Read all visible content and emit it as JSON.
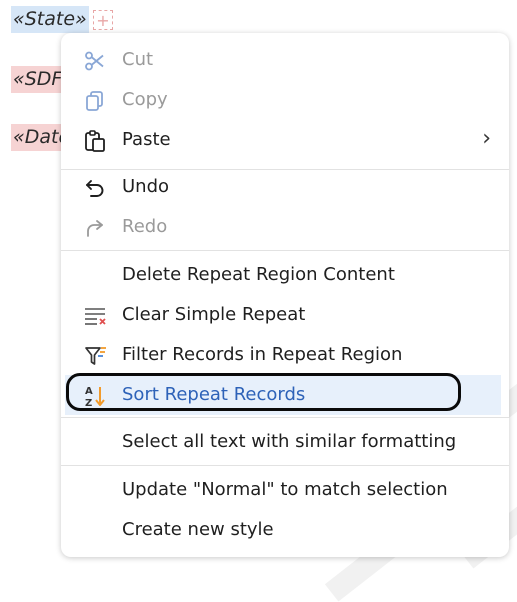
{
  "document": {
    "fields": [
      "«State»",
      "«SDF",
      "«Date"
    ],
    "add_symbol": "+"
  },
  "context_menu": {
    "items": [
      {
        "label": "Cut",
        "icon": "scissors-icon",
        "enabled": false
      },
      {
        "label": "Copy",
        "icon": "copy-icon",
        "enabled": false
      },
      {
        "label": "Paste",
        "icon": "clipboard-icon",
        "enabled": true,
        "submenu_indicator": "›"
      },
      {
        "label": "Undo",
        "icon": "undo-icon",
        "enabled": true
      },
      {
        "label": "Redo",
        "icon": "redo-icon",
        "enabled": false
      },
      {
        "label": "Delete Repeat Region Content",
        "enabled": true
      },
      {
        "label": "Clear Simple Repeat",
        "icon": "clear-list-icon",
        "enabled": true
      },
      {
        "label": "Filter Records in Repeat Region",
        "icon": "filter-icon",
        "enabled": true
      },
      {
        "label": "Sort Repeat Records",
        "icon": "sort-az-icon",
        "enabled": true,
        "highlighted": true
      },
      {
        "label": "Select all text with similar formatting",
        "enabled": true
      },
      {
        "label": "Update \"Normal\" to match selection",
        "enabled": true
      },
      {
        "label": "Create new style",
        "enabled": true
      }
    ]
  },
  "colors": {
    "highlight_bg": "#e7f0fb",
    "highlight_text": "#2d62b8",
    "disabled_text": "#9a9a9a",
    "field_blue": "#d6e6f7",
    "field_pink": "#f6d3d3"
  }
}
